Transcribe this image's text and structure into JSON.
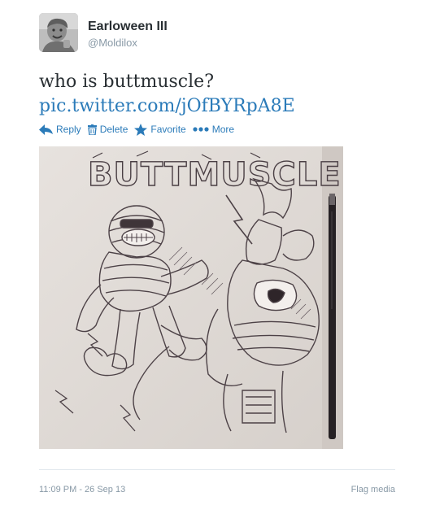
{
  "user": {
    "fullname": "Earloween III",
    "username": "@Moldilox"
  },
  "tweet": {
    "text": "who is buttmuscle?",
    "link": "pic.twitter.com/jOfBYRpA8E"
  },
  "actions": {
    "reply": "Reply",
    "delete": "Delete",
    "favorite": "Favorite",
    "more": "More"
  },
  "media": {
    "drawing_title": "BUTTMUSCLE"
  },
  "footer": {
    "timestamp": "11:09 PM - 26 Sep 13",
    "flag": "Flag media"
  },
  "colors": {
    "link": "#2b7bb9",
    "muted": "#8899a6",
    "text": "#292f33"
  }
}
